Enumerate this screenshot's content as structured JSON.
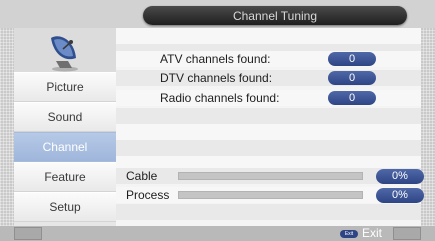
{
  "header": {
    "title": "Channel Tuning"
  },
  "sidebar": {
    "items": [
      {
        "label": "Picture",
        "active": false
      },
      {
        "label": "Sound",
        "active": false
      },
      {
        "label": "Channel",
        "active": true
      },
      {
        "label": "Feature",
        "active": false
      },
      {
        "label": "Setup",
        "active": false
      }
    ]
  },
  "results": {
    "atv_label": "ATV channels found:",
    "atv_value": "0",
    "dtv_label": "DTV channels found:",
    "dtv_value": "0",
    "radio_label": "Radio channels found:",
    "radio_value": "0"
  },
  "progress": {
    "cable_label": "Cable",
    "cable_value": "0%",
    "cable_fraction": 0,
    "process_label": "Process",
    "process_value": "0%",
    "process_fraction": 0
  },
  "footer": {
    "exit_key": "Exit",
    "exit_label": "Exit"
  },
  "colors": {
    "accent": "#2e4585",
    "active_nav": "#9fb6db"
  },
  "icons": {
    "logo": "satellite-dish-icon"
  }
}
